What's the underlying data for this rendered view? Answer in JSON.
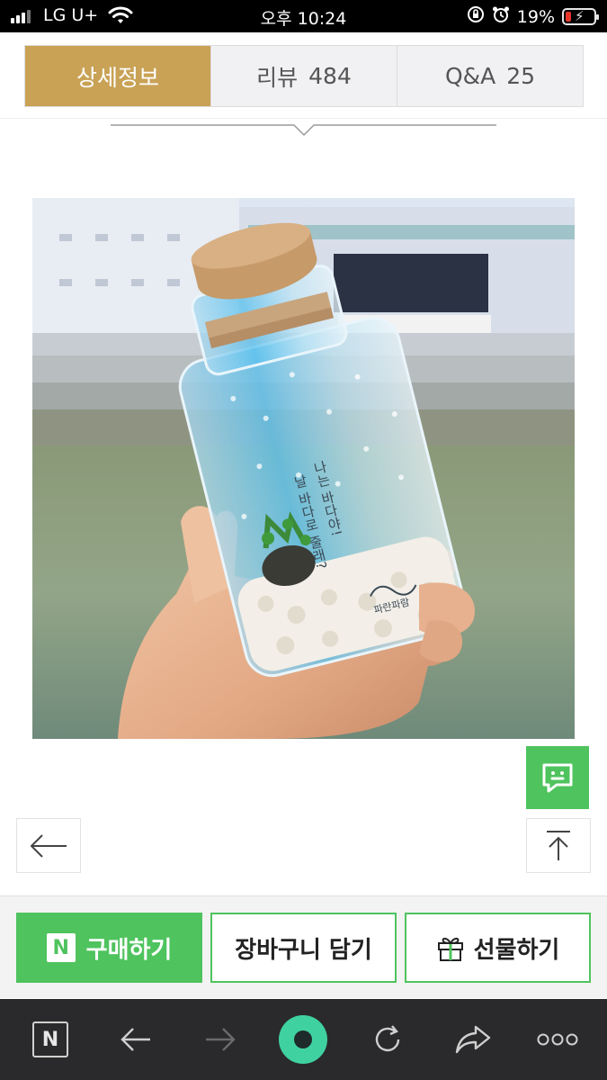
{
  "status_bar": {
    "carrier": "LG U+",
    "time": "오후 10:24",
    "battery": "19%",
    "battery_level": 0.19,
    "icons": [
      "signal-icon",
      "wifi-icon",
      "orientation-lock-icon",
      "alarm-icon",
      "battery-icon"
    ]
  },
  "tabs": [
    {
      "label": "상세정보",
      "count": ""
    },
    {
      "label": "리뷰",
      "count": "484"
    },
    {
      "label": "Q&A",
      "count": "25"
    }
  ],
  "photo": {
    "bottle_text_1": "나는 바다야!",
    "bottle_text_2": "날 바다로 줄래?",
    "bottle_brand": "파란파람"
  },
  "floating": {
    "icons": [
      "chat-icon",
      "arrow-left-icon",
      "scroll-top-icon"
    ]
  },
  "actions": {
    "buy": "구매하기",
    "buy_logo": "N",
    "cart": "장바구니 담기",
    "gift": "선물하기"
  },
  "toolbar": {
    "naver_logo": "N",
    "icons": [
      "naver-home-icon",
      "back-icon",
      "forward-icon",
      "green-dot-icon",
      "reload-icon",
      "share-icon",
      "more-icon"
    ]
  },
  "colors": {
    "tab_active": "#c9a256",
    "accent_green": "#4fc35e",
    "toolbar_bg": "#2a2a2c"
  }
}
